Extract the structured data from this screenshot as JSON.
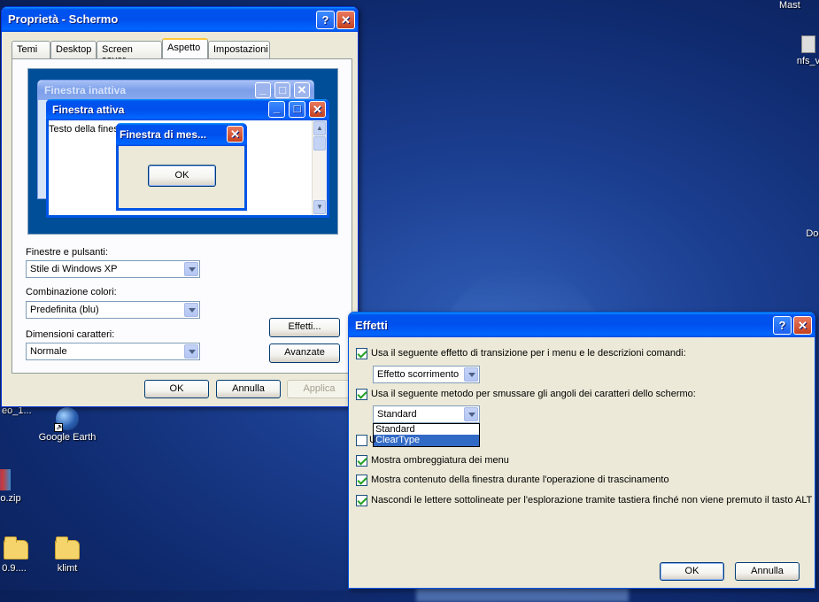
{
  "desktop": {
    "icons": [
      {
        "id": "mast",
        "label": "Mast"
      },
      {
        "id": "nfs",
        "label": "nfs_v"
      },
      {
        "id": "docu",
        "label": "N\nDocu"
      },
      {
        "id": "geo",
        "label": "eo_1..."
      },
      {
        "id": "gearth",
        "label": "Google Earth"
      },
      {
        "id": "zip",
        "label": "o.zip"
      },
      {
        "id": "ver",
        "label": "0.9...."
      },
      {
        "id": "klimt",
        "label": "klimt"
      }
    ]
  },
  "display_props": {
    "title": "Proprietà - Schermo",
    "tabs": [
      "Temi",
      "Desktop",
      "Screen saver",
      "Aspetto",
      "Impostazioni"
    ],
    "active_tab": "Aspetto",
    "preview": {
      "inactive_title": "Finestra inattiva",
      "active_title": "Finestra attiva",
      "window_text": "Testo della finestra",
      "msg_title": "Finestra di mes...",
      "msg_ok": "OK"
    },
    "windows_buttons_label": "Finestre e pulsanti:",
    "windows_buttons_value": "Stile di Windows XP",
    "color_scheme_label": "Combinazione colori:",
    "color_scheme_value": "Predefinita (blu)",
    "font_size_label": "Dimensioni caratteri:",
    "font_size_value": "Normale",
    "effects_button": "Effetti...",
    "advanced_button": "Avanzate",
    "ok": "OK",
    "cancel": "Annulla",
    "apply": "Applica"
  },
  "effects": {
    "title": "Effetti",
    "opt_transition": "Usa il seguente effetto di transizione per i menu e le descrizioni comandi:",
    "transition_value": "Effetto scorrimento",
    "opt_smooth": "Usa il seguente metodo per smussare gli angoli dei caratteri dello schermo:",
    "smooth_value": "Standard",
    "smooth_options": [
      "Standard",
      "ClearType"
    ],
    "opt_large_icons_fragment": "U",
    "opt_shadow": "Mostra ombreggiatura dei menu",
    "opt_drag": "Mostra contenuto della finestra durante l'operazione di trascinamento",
    "opt_underline": "Nascondi le lettere sottolineate per l'esplorazione tramite tastiera finché non viene premuto il tasto ALT",
    "ok": "OK",
    "cancel": "Annulla"
  }
}
